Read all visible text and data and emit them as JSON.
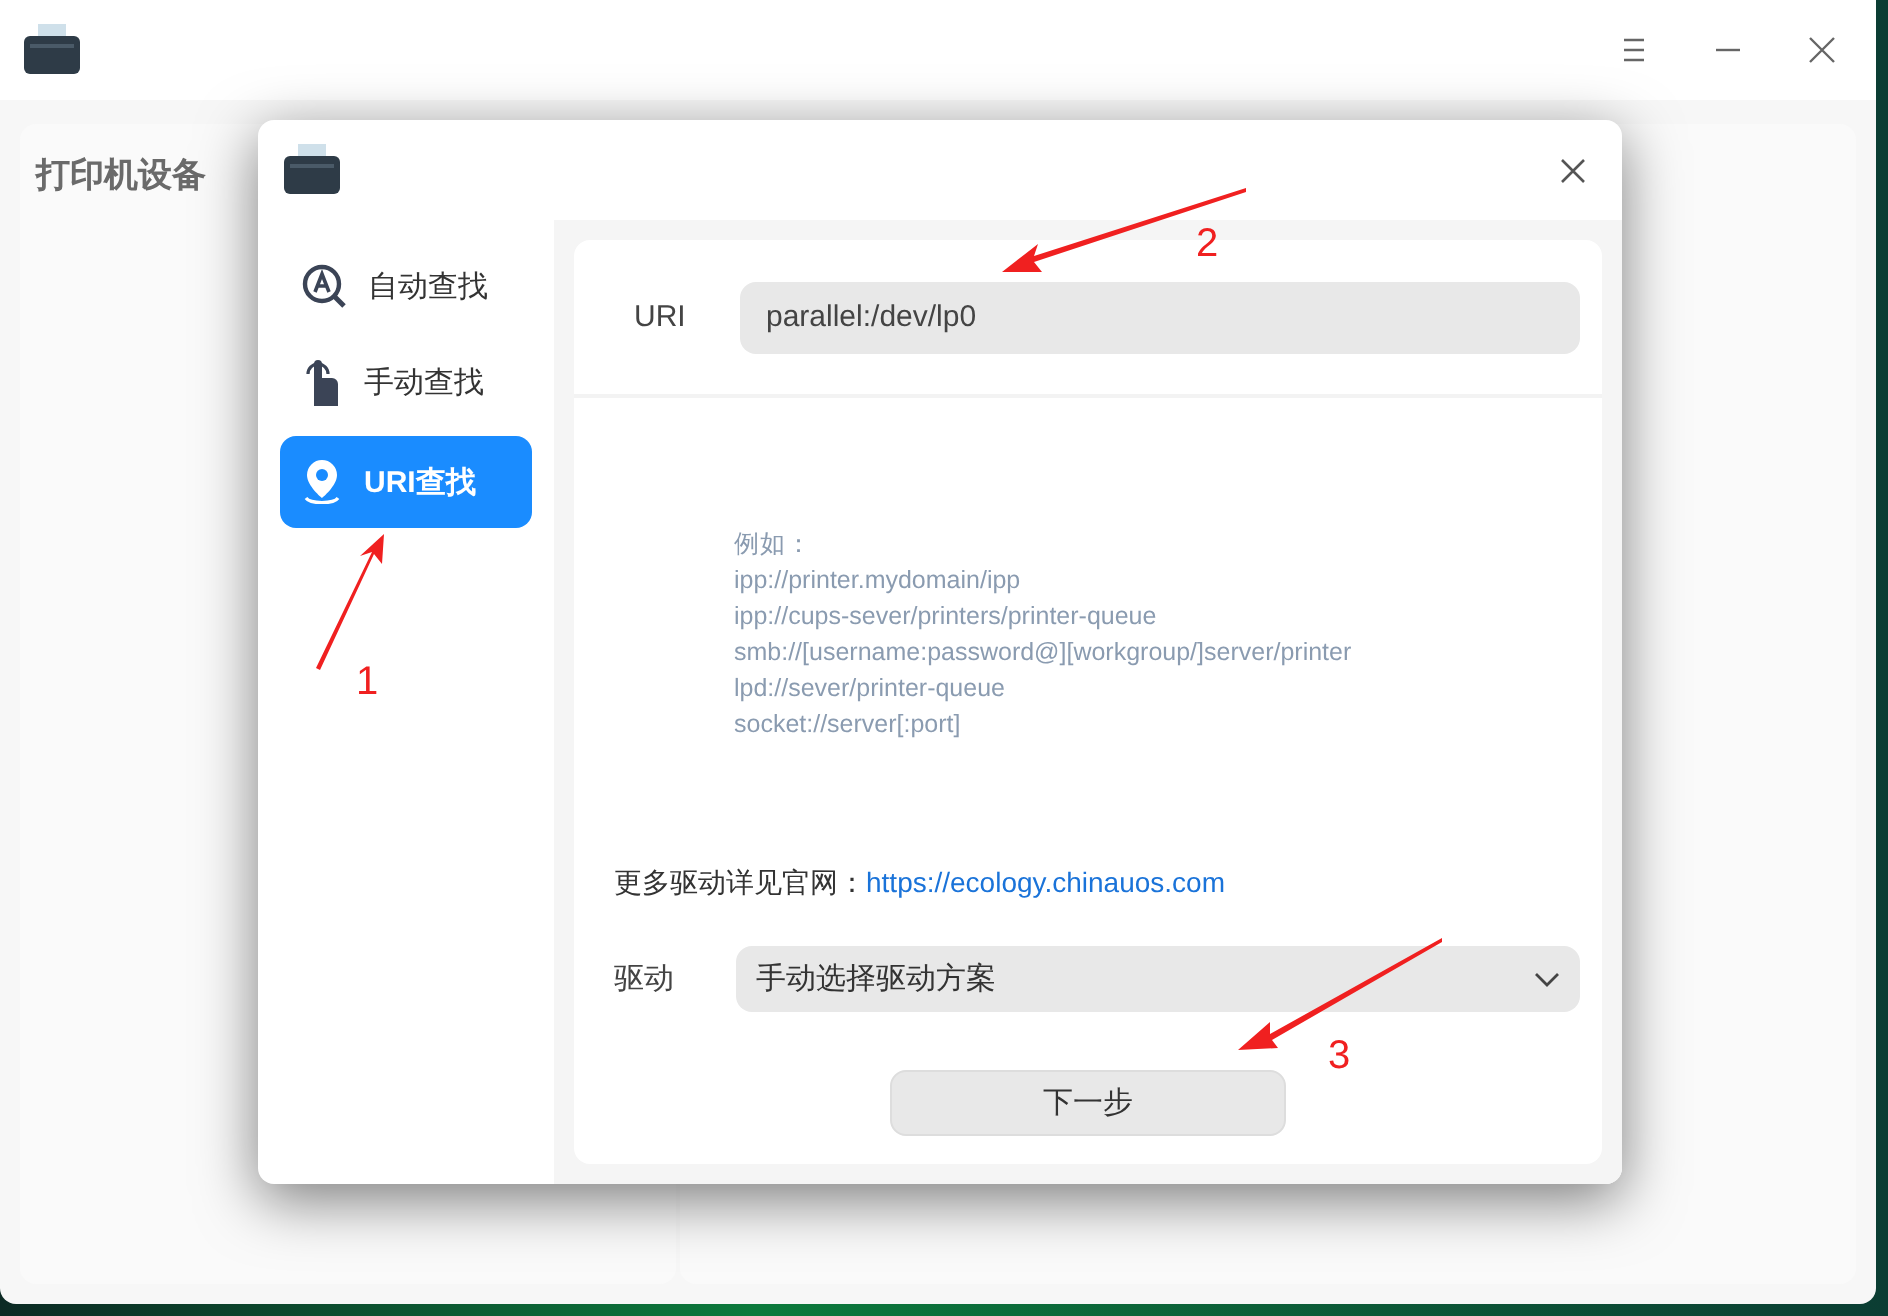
{
  "main_window": {
    "sidebar_title": "打印机设备"
  },
  "dialog": {
    "nav_items": [
      {
        "label": "自动查找",
        "selected": false
      },
      {
        "label": "手动查找",
        "selected": false
      },
      {
        "label": "URI查找",
        "selected": true
      }
    ],
    "uri": {
      "label": "URI",
      "value": "parallel:/dev/lp0"
    },
    "examples": [
      "例如：",
      "ipp://printer.mydomain/ipp",
      "ipp://cups-sever/printers/printer-queue",
      "smb://[username:password@][workgroup/]server/printer",
      "lpd://sever/printer-queue",
      "socket://server[:port]"
    ],
    "more_drivers": {
      "text": "更多驱动详见官网：",
      "link": "https://ecology.chinauos.com"
    },
    "driver": {
      "label": "驱动",
      "value": "手动选择驱动方案"
    },
    "next_button": "下一步"
  },
  "annotations": [
    "1",
    "2",
    "3"
  ]
}
